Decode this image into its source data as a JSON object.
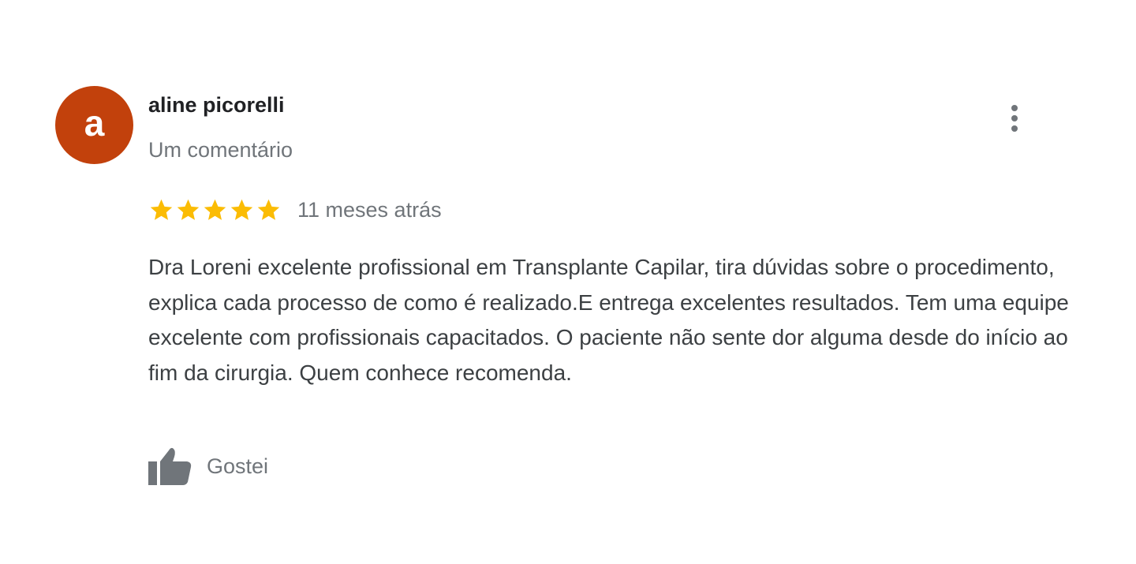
{
  "author": {
    "avatar_letter": "a",
    "avatar_color": "#c2410c",
    "name": "aline picorelli",
    "meta": "Um comentário"
  },
  "review": {
    "rating": 5,
    "rating_max": 5,
    "star_color": "#fbbc04",
    "date": "11 meses atrás",
    "text": "Dra Loreni excelente profissional em Transplante Capilar, tira dúvidas sobre o procedimento, explica cada processo de como é realizado.E entrega excelentes resultados. Tem uma equipe excelente com profissionais capacitados. O paciente não sente dor alguma desde do início ao fim da cirurgia. Quem conhece recomenda."
  },
  "actions": {
    "like_label": "Gostei",
    "like_icon": "thumbs-up-icon",
    "more_icon": "more-vert-icon"
  },
  "colors": {
    "name": "#202124",
    "secondary_text": "#70757a",
    "body_text": "#3c4043",
    "icon": "#70757a"
  }
}
